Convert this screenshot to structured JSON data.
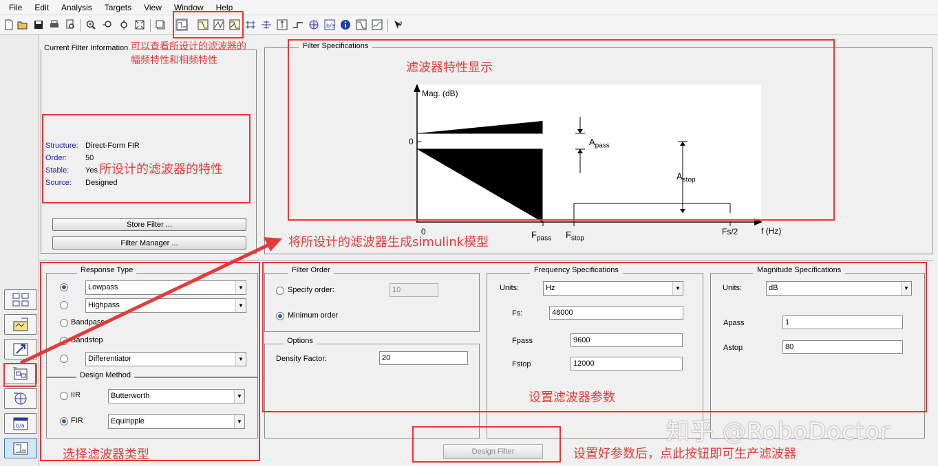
{
  "menu": [
    "File",
    "Edit",
    "Analysis",
    "Targets",
    "View",
    "Window",
    "Help"
  ],
  "toolbar_icons": [
    "new-icon",
    "open-icon",
    "save-icon",
    "print-icon",
    "print-preview-icon",
    "zoom-in-icon",
    "zoom-x-icon",
    "zoom-y-icon",
    "full-view-icon",
    "new-figure-icon",
    "filter-specs-icon",
    "magnitude-response-icon",
    "phase-response-icon",
    "magnitude-phase-icon",
    "group-delay-icon",
    "phase-delay-icon",
    "impulse-response-icon",
    "step-response-icon",
    "pole-zero-icon",
    "filter-coefficients-icon",
    "filter-info-icon",
    "magnitude-estimate-icon",
    "round-off-noise-icon",
    "whats-this-icon"
  ],
  "current_filter": {
    "title": "Current Filter Information",
    "rows": [
      {
        "label": "Structure:",
        "value": "Direct-Form FIR"
      },
      {
        "label": "Order:",
        "value": "50"
      },
      {
        "label": "Stable:",
        "value": "Yes"
      },
      {
        "label": "Source:",
        "value": "Designed"
      }
    ],
    "store_button": "Store Filter ...",
    "manager_button": "Filter Manager ..."
  },
  "filter_specs": {
    "title": "Filter Specifications",
    "mag_label": "Mag. (dB)",
    "zero_y": "0",
    "zero_x": "0",
    "a_pass": "A",
    "a_pass_sub": "pass",
    "a_stop": "A",
    "a_stop_sub": "stop",
    "f_pass": "F",
    "f_pass_sub": "pass",
    "f_stop": "F",
    "f_stop_sub": "stop",
    "fs2": "Fs/2",
    "f_hz": "f (Hz)"
  },
  "response_type": {
    "title": "Response Type",
    "options": [
      {
        "label": "Lowpass",
        "selected": true
      },
      {
        "label": "Highpass",
        "selected": false
      },
      {
        "label": "Bandpass",
        "selected": false
      },
      {
        "label": "Bandstop",
        "selected": false
      },
      {
        "label": "Differentiator",
        "selected": false
      }
    ]
  },
  "design_method": {
    "title": "Design Method",
    "iir_label": "IIR",
    "iir_value": "Butterworth",
    "fir_label": "FIR",
    "fir_value": "Equiripple"
  },
  "filter_order": {
    "title": "Filter Order",
    "specify_label": "Specify order:",
    "specify_value": "10",
    "minimum_label": "Minimum order"
  },
  "options": {
    "title": "Options",
    "density_label": "Density Factor:",
    "density_value": "20"
  },
  "freq_specs": {
    "title": "Frequency Specifications",
    "units_label": "Units:",
    "units_value": "Hz",
    "fs_label": "Fs:",
    "fs_value": "48000",
    "fpass_label": "Fpass",
    "fpass_value": "9600",
    "fstop_label": "Fstop",
    "fstop_value": "12000"
  },
  "mag_specs": {
    "title": "Magnitude Specifications",
    "units_label": "Units:",
    "units_value": "dB",
    "apass_label": "Apass",
    "apass_value": "1",
    "astop_label": "Astop",
    "astop_value": "80"
  },
  "design_button": "Design Filter",
  "annotations": {
    "view_response_line1": "可以查看所设计的滤波器的",
    "view_response_line2": "幅频特性和相频特性",
    "filter_display": "滤波器特性显示",
    "filter_properties": "所设计的滤波器的特性",
    "simulink": "将所设计的滤波器生成simulink模型",
    "set_params": "设置滤波器参数",
    "select_type": "选择滤波器类型",
    "design_hint": "设置好参数后，点此按钮即可生产滤波器"
  },
  "watermark": "知乎 @RoboDoctor",
  "colors": {
    "annotation": "#e53a3a",
    "label_blue": "#1a1aa6",
    "radio": "#2a5fb5"
  }
}
